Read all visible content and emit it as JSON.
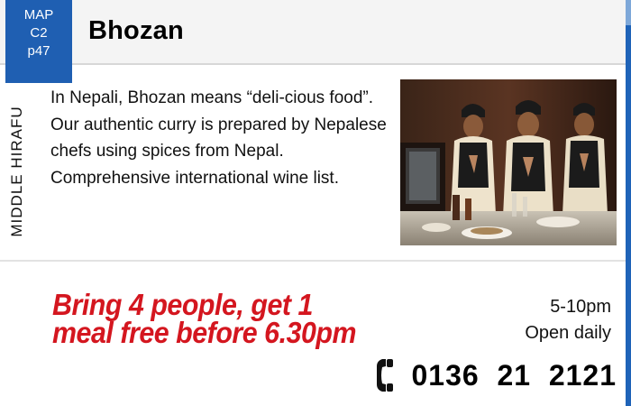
{
  "listing": {
    "map_ref": {
      "line1": "MAP",
      "line2": "C2",
      "line3": "p47"
    },
    "title": "Bhozan",
    "district": "MIDDLE HIRAFU",
    "description": "In Nepali, Bhozan means “deli-cious food”. Our authentic curry is prepared by Nepalese chefs using spices from Nepal. Comprehensive international wine list.",
    "promo": "Bring 4 people, get 1 meal free before 6.30pm",
    "hours": {
      "time": "5-10pm",
      "days": "Open daily"
    },
    "phone": "0136  21  2121",
    "icons": {
      "phone": "phone-icon"
    },
    "colors": {
      "accent_blue": "#1f5fb2",
      "promo_red": "#d4161f"
    }
  }
}
